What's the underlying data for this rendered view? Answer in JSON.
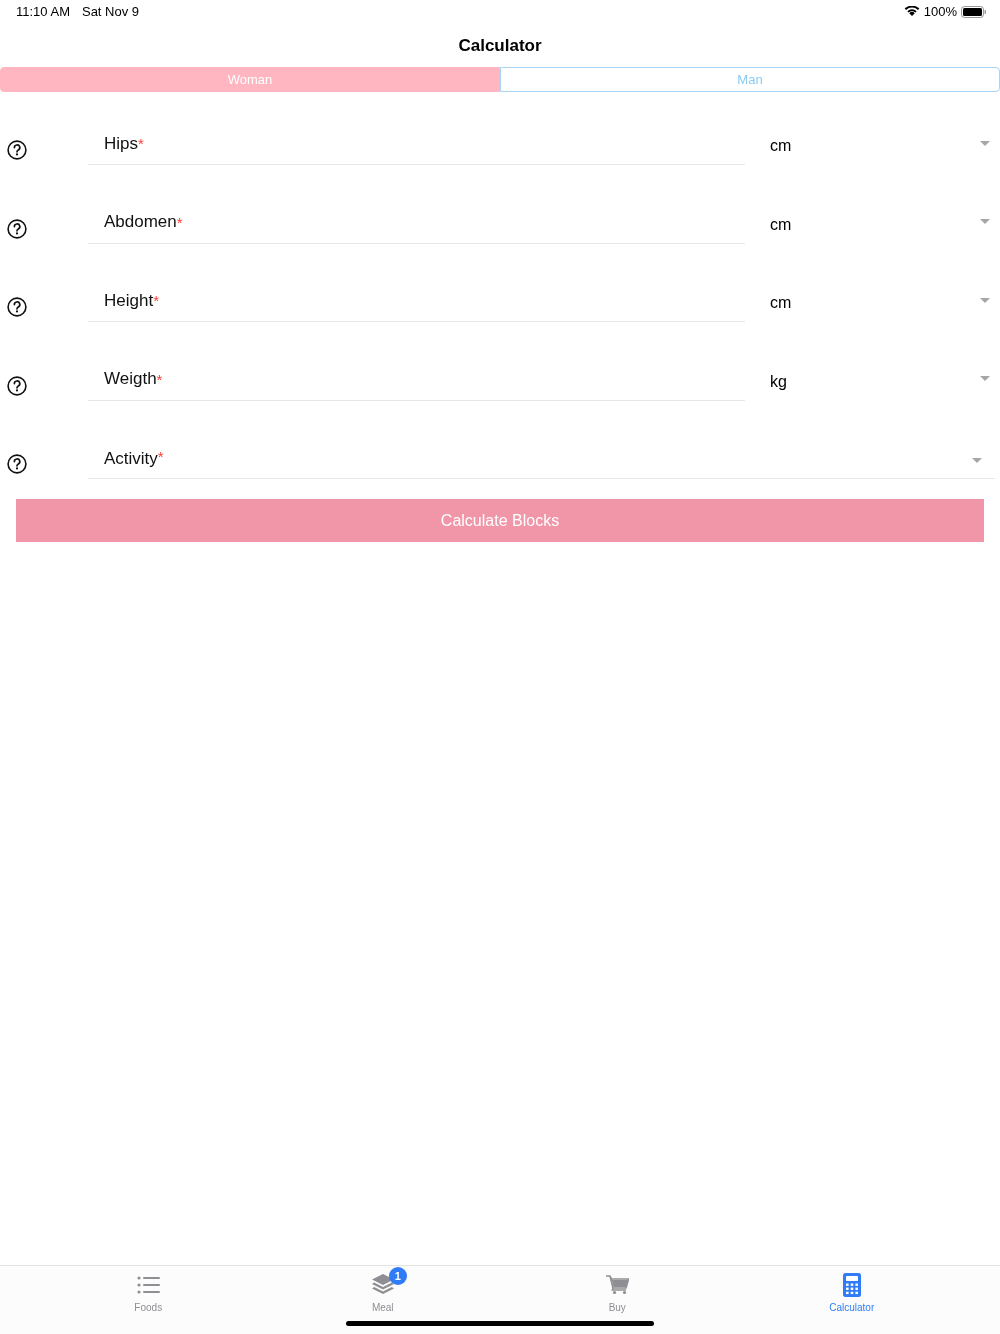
{
  "status_bar": {
    "time": "11:10 AM",
    "date": "Sat Nov 9",
    "battery": "100%"
  },
  "nav": {
    "title": "Calculator"
  },
  "segments": [
    {
      "label": "Woman",
      "selected": true
    },
    {
      "label": "Man",
      "selected": false
    }
  ],
  "fields": [
    {
      "kind": "measure",
      "label": "Hips",
      "required_mark": "*",
      "unit": "cm"
    },
    {
      "kind": "measure",
      "label": "Abdomen",
      "required_mark": "*",
      "unit": "cm"
    },
    {
      "kind": "measure",
      "label": "Height",
      "required_mark": "*",
      "unit": "cm"
    },
    {
      "kind": "measure",
      "label": "Weigth",
      "required_mark": "*",
      "unit": "kg"
    },
    {
      "kind": "select",
      "label": "Activity",
      "required_mark": "*"
    }
  ],
  "calculate_button": {
    "label": "Calculate Blocks",
    "disabled": true
  },
  "tab_bar": [
    {
      "label": "Foods",
      "selected": false
    },
    {
      "label": "Meal",
      "selected": false,
      "badge": "1"
    },
    {
      "label": "Buy",
      "selected": false
    },
    {
      "label": "Calculator",
      "selected": true
    }
  ]
}
